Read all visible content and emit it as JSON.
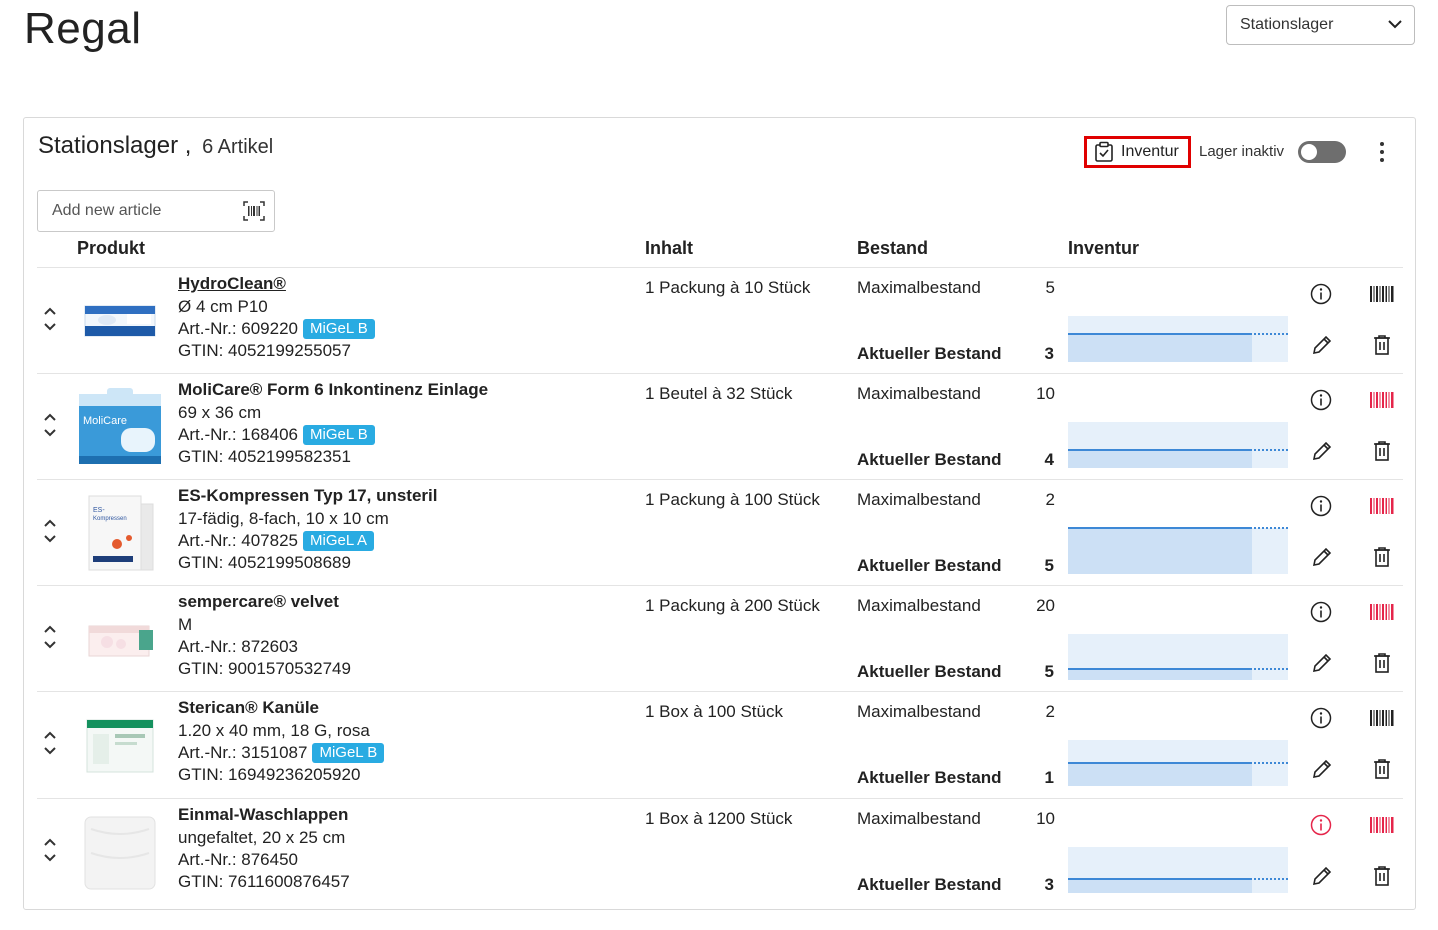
{
  "page": {
    "title": "Regal"
  },
  "store_select": {
    "value": "Stationslager"
  },
  "card": {
    "title": "Stationslager ,",
    "count": "6 Artikel",
    "inventur_label": "Inventur",
    "lager_label": "Lager inaktiv",
    "lager_active": false
  },
  "add_article": {
    "placeholder": "Add new article"
  },
  "headers": {
    "produkt": "Produkt",
    "inhalt": "Inhalt",
    "bestand": "Bestand",
    "inventur": "Inventur"
  },
  "labels": {
    "max": "Maximalbestand",
    "current": "Aktueller Bestand"
  },
  "colors": {
    "accent": "#29abe2",
    "gauge": "#3d88d6",
    "highlight": "#e00000",
    "alert": "#e5254a"
  },
  "products": [
    {
      "name": "HydroClean®",
      "desc": "Ø 4 cm P10",
      "art": "Art.-Nr.: 609220",
      "migel": "MiGeL B",
      "gtin": "GTIN: 4052199255057",
      "inhalt": "1 Packung à 10 Stück",
      "max": "5",
      "current": "3",
      "max_value": 5,
      "current_value": 3,
      "barcode_color": "#222222",
      "info_alert": false
    },
    {
      "name": "MoliCare® Form 6 Inkontinenz Einlage",
      "desc": "69 x 36 cm",
      "art": "Art.-Nr.: 168406",
      "migel": "MiGeL B",
      "gtin": "GTIN: 4052199582351",
      "inhalt": "1 Beutel à 32 Stück",
      "max": "10",
      "current": "4",
      "max_value": 10,
      "current_value": 4,
      "barcode_color": "#e5254a",
      "info_alert": false
    },
    {
      "name": "ES-Kompressen Typ 17, unsteril",
      "desc": "17-fädig, 8-fach, 10 x 10 cm",
      "art": "Art.-Nr.: 407825",
      "migel": "MiGeL A",
      "gtin": "GTIN: 4052199508689",
      "inhalt": "1 Packung à 100 Stück",
      "max": "2",
      "current": "5",
      "max_value": 2,
      "current_value": 5,
      "barcode_color": "#e5254a",
      "info_alert": false
    },
    {
      "name": "sempercare® velvet",
      "desc": "M",
      "art": "Art.-Nr.: 872603",
      "migel": "",
      "gtin": "GTIN: 9001570532749",
      "inhalt": "1 Packung à 200 Stück",
      "max": "20",
      "current": "5",
      "max_value": 20,
      "current_value": 5,
      "barcode_color": "#e5254a",
      "info_alert": false
    },
    {
      "name": "Sterican® Kanüle",
      "desc": "1.20 x 40 mm, 18 G, rosa",
      "art": "Art.-Nr.: 3151087",
      "migel": "MiGeL B",
      "gtin": "GTIN: 16949236205920",
      "inhalt": "1 Box à 100 Stück",
      "max": "2",
      "current": "1",
      "max_value": 2,
      "current_value": 1,
      "barcode_color": "#222222",
      "info_alert": false
    },
    {
      "name": "Einmal-Waschlappen",
      "desc": "ungefaltet, 20 x 25 cm",
      "art": "Art.-Nr.: 876450",
      "migel": "",
      "gtin": "GTIN: 7611600876457",
      "inhalt": "1 Box à 1200 Stück",
      "max": "10",
      "current": "3",
      "max_value": 10,
      "current_value": 3,
      "barcode_color": "#e5254a",
      "info_alert": true
    }
  ]
}
